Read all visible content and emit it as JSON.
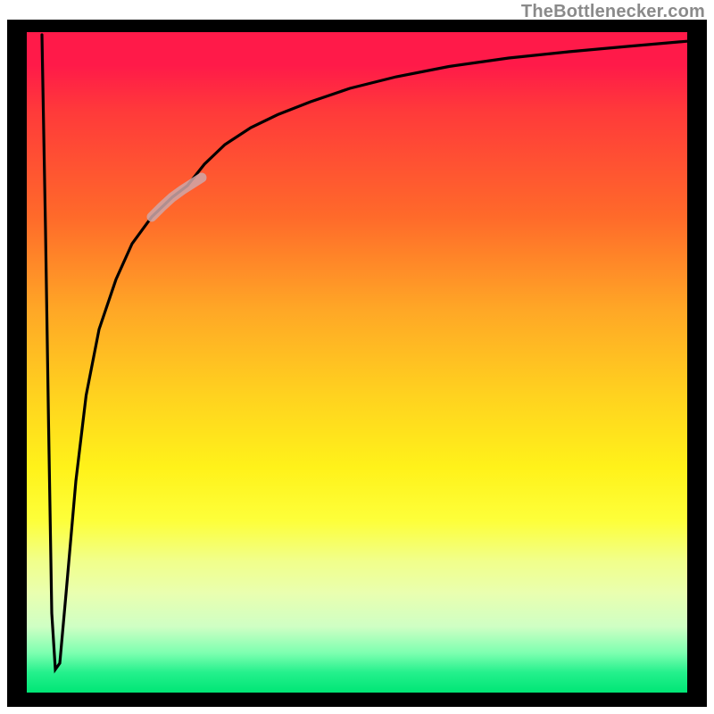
{
  "watermark": {
    "text": "TheBottlenecker.com"
  },
  "colors": {
    "frame": "#000000",
    "curve": "#000000",
    "highlight": "#cfa7a8",
    "gradient_top": "#ff1a49",
    "gradient_bottom": "#00e676"
  },
  "chart_data": {
    "type": "line",
    "title": "",
    "xlabel": "",
    "ylabel": "",
    "xlim": [
      0,
      100
    ],
    "ylim": [
      0,
      100
    ],
    "grid": false,
    "legend": false,
    "note": "Axes are unlabeled; values are normalized 0–100 estimated from pixel positions. Curve is a single black trace that spikes from top-left down to near (4, 4) then sweeps back up asymptotically toward y≈99 at the right edge.",
    "series": [
      {
        "name": "main-curve",
        "x": [
          2.3,
          2.9,
          3.3,
          3.8,
          4.3,
          5.0,
          6.0,
          7.5,
          9.0,
          11.0,
          13.5,
          16.0,
          19.0,
          22.0,
          24.3,
          27.0,
          30.0,
          34.0,
          38.0,
          43.0,
          49.0,
          56.0,
          64.0,
          73.0,
          82.0,
          91.0,
          100.0
        ],
        "y": [
          99.5,
          70.0,
          40.0,
          12.0,
          3.5,
          4.5,
          15.0,
          32.0,
          45.0,
          55.0,
          62.5,
          68.0,
          72.0,
          75.0,
          76.8,
          80.0,
          83.0,
          85.5,
          87.5,
          89.5,
          91.5,
          93.3,
          94.8,
          96.0,
          97.0,
          97.8,
          98.7
        ]
      },
      {
        "name": "highlight-segment",
        "x": [
          19.0,
          20.5,
          22.0,
          23.5,
          25.0,
          26.5
        ],
        "y": [
          72.0,
          73.5,
          75.0,
          76.0,
          77.0,
          78.0
        ]
      }
    ]
  }
}
